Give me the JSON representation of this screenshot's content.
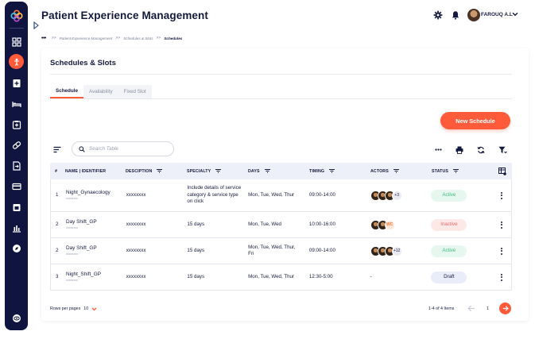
{
  "app": {
    "title": "Patient Experience Management",
    "user_name": "FAROUQ A.L"
  },
  "breadcrumb": {
    "items": [
      "Patient Experience Management",
      "Schedules & Slots",
      "Schedules"
    ]
  },
  "page": {
    "title": "Schedules & Slots",
    "tabs": [
      {
        "label": "Schedule",
        "active": true
      },
      {
        "label": "Availability",
        "active": false
      },
      {
        "label": "Fixed Slot",
        "active": false
      }
    ],
    "new_button_label": "New Schedule",
    "search_placeholder": "Search Table"
  },
  "table": {
    "columns": [
      "#",
      "NAME | IDENTIFIER",
      "DESCIPTION",
      "SPECIALTY",
      "DAYS",
      "TIMING",
      "ACTORS",
      "STATUS"
    ],
    "rows": [
      {
        "num": "1",
        "name": "Night_Gynaecology",
        "identifier": "xxxxxxxx",
        "description": "xxxxxxxx",
        "specialty": "Include details of service category & service type on click",
        "days": "Mon, Tue, Wed, Thur",
        "timing": "09:00-14:00",
        "actors_extra": "+3",
        "actors_initials": "",
        "status": "Active",
        "status_type": "active"
      },
      {
        "num": "2",
        "name": "Day Shift_GP",
        "identifier": "xxxxxxxx",
        "description": "xxxxxxxx",
        "specialty": "15 days",
        "days": "Mon, Tue, Wed",
        "timing": "10:00-16:00",
        "actors_extra": "",
        "actors_initials": "WC",
        "status": "Inactive",
        "status_type": "inactive"
      },
      {
        "num": "2",
        "name": "Day Shift_GP",
        "identifier": "xxxxxxxx",
        "description": "xxxxxxxx",
        "specialty": "15 days",
        "days": "Mon, Tue, Wed, Thur, Fri",
        "timing": "09:00-14:00",
        "actors_extra": "+12",
        "actors_initials": "",
        "status": "Active",
        "status_type": "active"
      },
      {
        "num": "3",
        "name": "Night_Shift_GP",
        "identifier": "xxxxxxxx",
        "description": "xxxxxxxx",
        "specialty": "15 days",
        "days": "Mon, Tue, Wed, Thur",
        "timing": "12:30-5:00",
        "actors_text": "-",
        "actors_extra": "",
        "actors_initials": "",
        "status": "Draft",
        "status_type": "draft"
      }
    ]
  },
  "footer": {
    "rows_per_page_label": "Rows per pages",
    "rows_per_page_value": "10",
    "range": "1-4 of 4 Items",
    "page": "1"
  },
  "colors": {
    "accent": "#ff5b3a",
    "sidebar": "#101540",
    "header_row": "#edf0f9"
  }
}
